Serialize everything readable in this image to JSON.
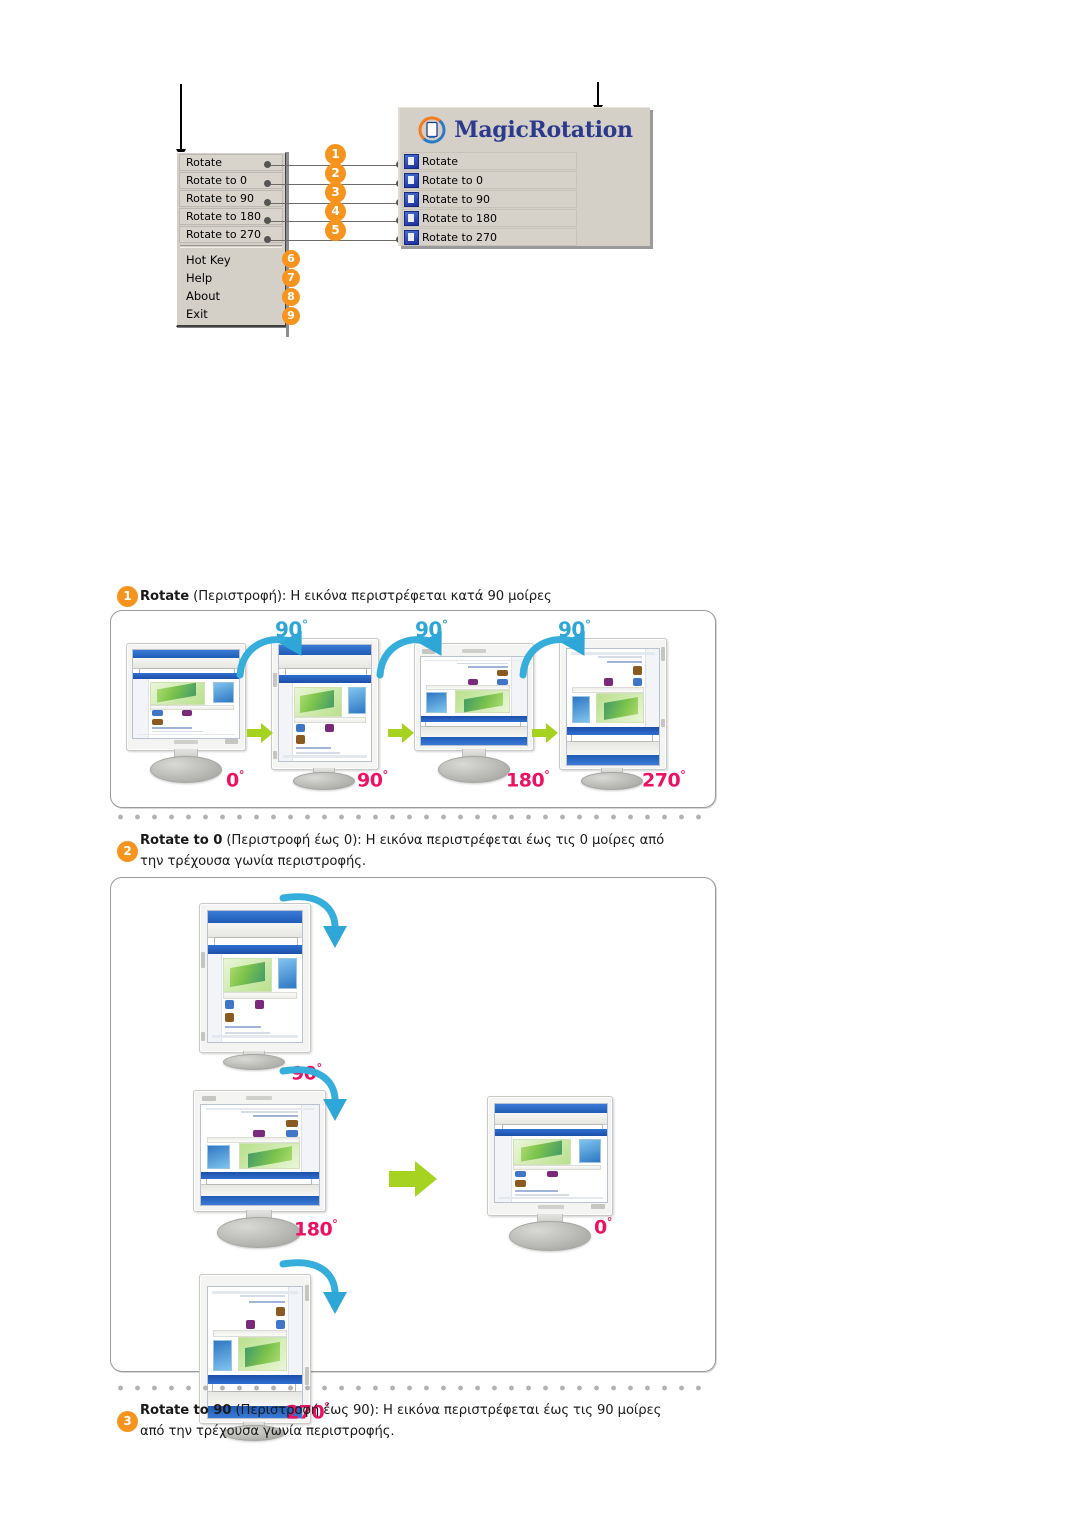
{
  "page": {
    "background": "#ffffff",
    "accent_orange": "#F7941E",
    "accent_pink": "#ED1164",
    "accent_cyan": "#2EA7D8",
    "accent_green": "#A5D31F",
    "brand_blue": "#2B3A8C"
  },
  "top_diagram": {
    "pointer_left_name": "pointer-arrow-context-menu",
    "pointer_right_name": "pointer-arrow-magicrotation-panel",
    "context_menu": {
      "boxed_items": [
        {
          "label": "Rotate",
          "badge": "1"
        },
        {
          "label": "Rotate to 0",
          "badge": "2"
        },
        {
          "label": "Rotate to 90",
          "badge": "3"
        },
        {
          "label": "Rotate to 180",
          "badge": "4"
        },
        {
          "label": "Rotate to 270",
          "badge": "5"
        }
      ],
      "plain_items": [
        {
          "label": "Hot Key",
          "badge": "6"
        },
        {
          "label": "Help",
          "badge": "7"
        },
        {
          "label": "About",
          "badge": "8"
        },
        {
          "label": "Exit",
          "badge": "9"
        }
      ]
    },
    "magicrotation_panel": {
      "logo_icon": "magicrotation-logo-icon",
      "wordmark": "MagicRotation",
      "items": [
        {
          "label": "Rotate",
          "icon": "rotate-icon"
        },
        {
          "label": "Rotate to 0",
          "icon": "rotate-to-0-icon"
        },
        {
          "label": "Rotate to 90",
          "icon": "rotate-to-90-icon"
        },
        {
          "label": "Rotate to 180",
          "icon": "rotate-to-180-icon"
        },
        {
          "label": "Rotate to 270",
          "icon": "rotate-to-270-icon"
        }
      ]
    }
  },
  "sections": [
    {
      "badge": "1",
      "term": "Rotate",
      "description": " (Περιστροφή):  Η εικόνα περιστρέφεται κατά 90 μοίρες",
      "figure": {
        "name": "figure-rotate-sequence",
        "steps": [
          {
            "angle_label": "0",
            "arrow_label": "90"
          },
          {
            "angle_label": "90",
            "arrow_label": "90"
          },
          {
            "angle_label": "180",
            "arrow_label": "90"
          },
          {
            "angle_label": "270",
            "arrow_label": ""
          }
        ]
      }
    },
    {
      "badge": "2",
      "term": "Rotate to 0",
      "description": " (Περιστροφή έως 0): Η εικόνα περιστρέφεται έως τις 0 μοίρες από",
      "description_line2": "την τρέχουσα γωνία περιστροφής.",
      "figure": {
        "name": "figure-rotate-to-0",
        "sources": [
          {
            "angle_label": "90"
          },
          {
            "angle_label": "180"
          },
          {
            "angle_label": "270"
          }
        ],
        "target": {
          "angle_label": "0"
        }
      }
    },
    {
      "badge": "3",
      "term": "Rotate to 90",
      "description": " (Περιστροφή έως 90): Η εικόνα περιστρέφεται έως τις 90 μοίρες",
      "description_line2": "από την τρέχουσα γωνία περιστροφής."
    }
  ],
  "degree_symbol": "°"
}
